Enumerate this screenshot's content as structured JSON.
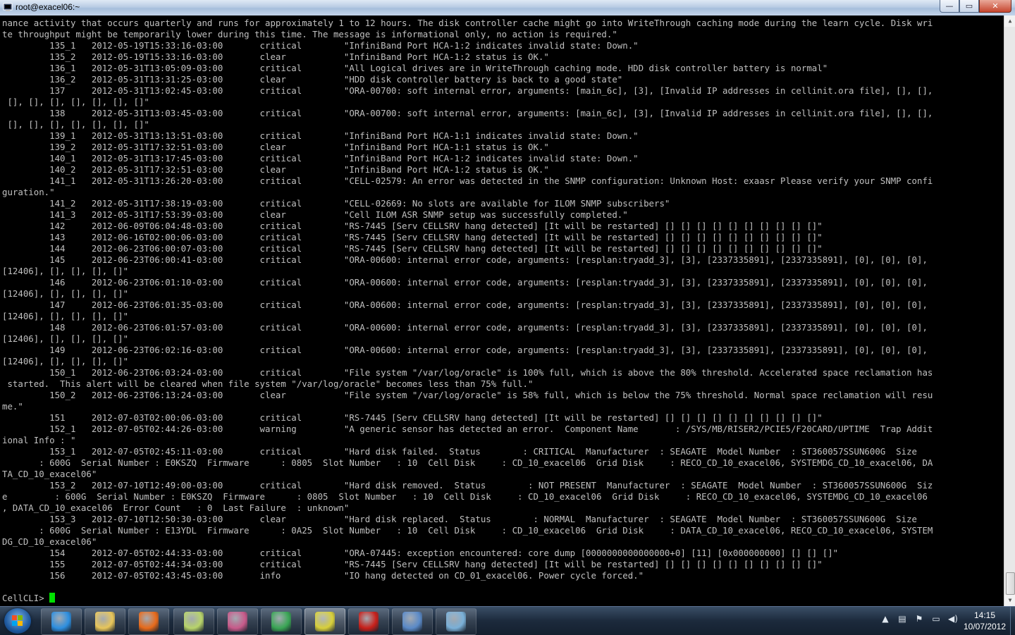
{
  "window": {
    "title": "root@exacel06:~",
    "buttons": {
      "minimize": "—",
      "maximize": "▭",
      "close": "✕"
    }
  },
  "terminal": {
    "lines": [
      "nance activity that occurs quarterly and runs for approximately 1 to 12 hours. The disk controller cache might go into WriteThrough caching mode during the learn cycle. Disk wri",
      "te throughput might be temporarily lower during this time. The message is informational only, no action is required.\"",
      "         135_1   2012-05-19T15:33:16-03:00       critical        \"InfiniBand Port HCA-1:2 indicates invalid state: Down.\"",
      "         135_2   2012-05-19T15:33:16-03:00       clear           \"InfiniBand Port HCA-1:2 status is OK.\"",
      "         136_1   2012-05-31T13:05:09-03:00       critical        \"All Logical drives are in WriteThrough caching mode. HDD disk controller battery is normal\"",
      "         136_2   2012-05-31T13:31:25-03:00       clear           \"HDD disk controller battery is back to a good state\"",
      "         137     2012-05-31T13:02:45-03:00       critical        \"ORA-00700: soft internal error, arguments: [main_6c], [3], [Invalid IP addresses in cellinit.ora file], [], [],",
      " [], [], [], [], [], [], []\"",
      "         138     2012-05-31T13:03:45-03:00       critical        \"ORA-00700: soft internal error, arguments: [main_6c], [3], [Invalid IP addresses in cellinit.ora file], [], [],",
      " [], [], [], [], [], [], []\"",
      "         139_1   2012-05-31T13:13:51-03:00       critical        \"InfiniBand Port HCA-1:1 indicates invalid state: Down.\"",
      "         139_2   2012-05-31T17:32:51-03:00       clear           \"InfiniBand Port HCA-1:1 status is OK.\"",
      "         140_1   2012-05-31T13:17:45-03:00       critical        \"InfiniBand Port HCA-1:2 indicates invalid state: Down.\"",
      "         140_2   2012-05-31T17:32:51-03:00       clear           \"InfiniBand Port HCA-1:2 status is OK.\"",
      "         141_1   2012-05-31T13:26:20-03:00       critical        \"CELL-02579: An error was detected in the SNMP configuration: Unknown Host: exaasr Please verify your SNMP confi",
      "guration.\"",
      "         141_2   2012-05-31T17:38:19-03:00       critical        \"CELL-02669: No slots are available for ILOM SNMP subscribers\"",
      "         141_3   2012-05-31T17:53:39-03:00       clear           \"Cell ILOM ASR SNMP setup was successfully completed.\"",
      "         142     2012-06-09T06:04:48-03:00       critical        \"RS-7445 [Serv CELLSRV hang detected] [It will be restarted] [] [] [] [] [] [] [] [] [] []\"",
      "         143     2012-06-16T02:00:06-03:00       critical        \"RS-7445 [Serv CELLSRV hang detected] [It will be restarted] [] [] [] [] [] [] [] [] [] []\"",
      "         144     2012-06-23T06:00:07-03:00       critical        \"RS-7445 [Serv CELLSRV hang detected] [It will be restarted] [] [] [] [] [] [] [] [] [] []\"",
      "         145     2012-06-23T06:00:41-03:00       critical        \"ORA-00600: internal error code, arguments: [resplan:tryadd_3], [3], [2337335891], [2337335891], [0], [0], [0],",
      "[12406], [], [], [], []\"",
      "         146     2012-06-23T06:01:10-03:00       critical        \"ORA-00600: internal error code, arguments: [resplan:tryadd_3], [3], [2337335891], [2337335891], [0], [0], [0],",
      "[12406], [], [], [], []\"",
      "         147     2012-06-23T06:01:35-03:00       critical        \"ORA-00600: internal error code, arguments: [resplan:tryadd_3], [3], [2337335891], [2337335891], [0], [0], [0],",
      "[12406], [], [], [], []\"",
      "         148     2012-06-23T06:01:57-03:00       critical        \"ORA-00600: internal error code, arguments: [resplan:tryadd_3], [3], [2337335891], [2337335891], [0], [0], [0],",
      "[12406], [], [], [], []\"",
      "         149     2012-06-23T06:02:16-03:00       critical        \"ORA-00600: internal error code, arguments: [resplan:tryadd_3], [3], [2337335891], [2337335891], [0], [0], [0],",
      "[12406], [], [], [], []\"",
      "         150_1   2012-06-23T06:03:24-03:00       critical        \"File system \"/var/log/oracle\" is 100% full, which is above the 80% threshold. Accelerated space reclamation has",
      " started.  This alert will be cleared when file system \"/var/log/oracle\" becomes less than 75% full.\"",
      "         150_2   2012-06-23T06:13:24-03:00       clear           \"File system \"/var/log/oracle\" is 58% full, which is below the 75% threshold. Normal space reclamation will resu",
      "me.\"",
      "         151     2012-07-03T02:00:06-03:00       critical        \"RS-7445 [Serv CELLSRV hang detected] [It will be restarted] [] [] [] [] [] [] [] [] [] []\"",
      "         152_1   2012-07-05T02:44:26-03:00       warning         \"A generic sensor has detected an error.  Component Name       : /SYS/MB/RISER2/PCIE5/F20CARD/UPTIME  Trap Addit",
      "ional Info : \"",
      "         153_1   2012-07-05T02:45:11-03:00       critical        \"Hard disk failed.  Status        : CRITICAL  Manufacturer  : SEAGATE  Model Number  : ST360057SSUN600G  Size",
      "       : 600G  Serial Number : E0KSZQ  Firmware      : 0805  Slot Number   : 10  Cell Disk     : CD_10_exacel06  Grid Disk     : RECO_CD_10_exacel06, SYSTEMDG_CD_10_exacel06, DA",
      "TA_CD_10_exacel06\"",
      "         153_2   2012-07-10T12:49:00-03:00       critical        \"Hard disk removed.  Status        : NOT PRESENT  Manufacturer  : SEAGATE  Model Number  : ST360057SSUN600G  Siz",
      "e         : 600G  Serial Number : E0KSZQ  Firmware      : 0805  Slot Number   : 10  Cell Disk     : CD_10_exacel06  Grid Disk     : RECO_CD_10_exacel06, SYSTEMDG_CD_10_exacel06",
      ", DATA_CD_10_exacel06  Error Count   : 0  Last Failure  : unknown\"",
      "         153_3   2012-07-10T12:50:30-03:00       clear           \"Hard disk replaced.  Status        : NORMAL  Manufacturer  : SEAGATE  Model Number  : ST360057SSUN600G  Size",
      "       : 600G  Serial Number : E13YDL  Firmware      : 0A25  Slot Number   : 10  Cell Disk     : CD_10_exacel06  Grid Disk     : DATA_CD_10_exacel06, RECO_CD_10_exacel06, SYSTEM",
      "DG_CD_10_exacel06\"",
      "         154     2012-07-05T02:44:33-03:00       critical        \"ORA-07445: exception encountered: core dump [0000000000000000+0] [11] [0x000000000] [] [] []\"",
      "         155     2012-07-05T02:44:34-03:00       critical        \"RS-7445 [Serv CELLSRV hang detected] [It will be restarted] [] [] [] [] [] [] [] [] [] []\"",
      "         156     2012-07-05T02:43:45-03:00       info            \"IO hang detected on CD_01_exacel06. Power cycle forced.\""
    ],
    "prompt": "CellCLI> "
  },
  "taskbar": {
    "apps": [
      {
        "name": "internet-explorer",
        "icon": "ie-icon",
        "color": "#2d8fe0"
      },
      {
        "name": "file-explorer",
        "icon": "folder-icon",
        "color": "#e8c65a"
      },
      {
        "name": "firefox",
        "icon": "firefox-icon",
        "color": "#e86a1a"
      },
      {
        "name": "notepad",
        "icon": "notepad-icon",
        "color": "#b8d46a"
      },
      {
        "name": "database-tool",
        "icon": "database-icon",
        "color": "#c85a8a"
      },
      {
        "name": "chrome",
        "icon": "chrome-icon",
        "color": "#3aa655"
      },
      {
        "name": "putty",
        "icon": "putty-icon",
        "color": "#d8d03a"
      },
      {
        "name": "acrobat",
        "icon": "acrobat-icon",
        "color": "#c8201a"
      },
      {
        "name": "thunderbird",
        "icon": "thunderbird-icon",
        "color": "#5a8ac8"
      },
      {
        "name": "paint",
        "icon": "paint-icon",
        "color": "#7ab0d8"
      }
    ],
    "clock": {
      "time": "14:15",
      "date": "10/07/2012"
    },
    "tray": {
      "chevron": "▲",
      "network": "▤",
      "flag": "⚑",
      "display": "▭",
      "volume": "◀)"
    }
  }
}
